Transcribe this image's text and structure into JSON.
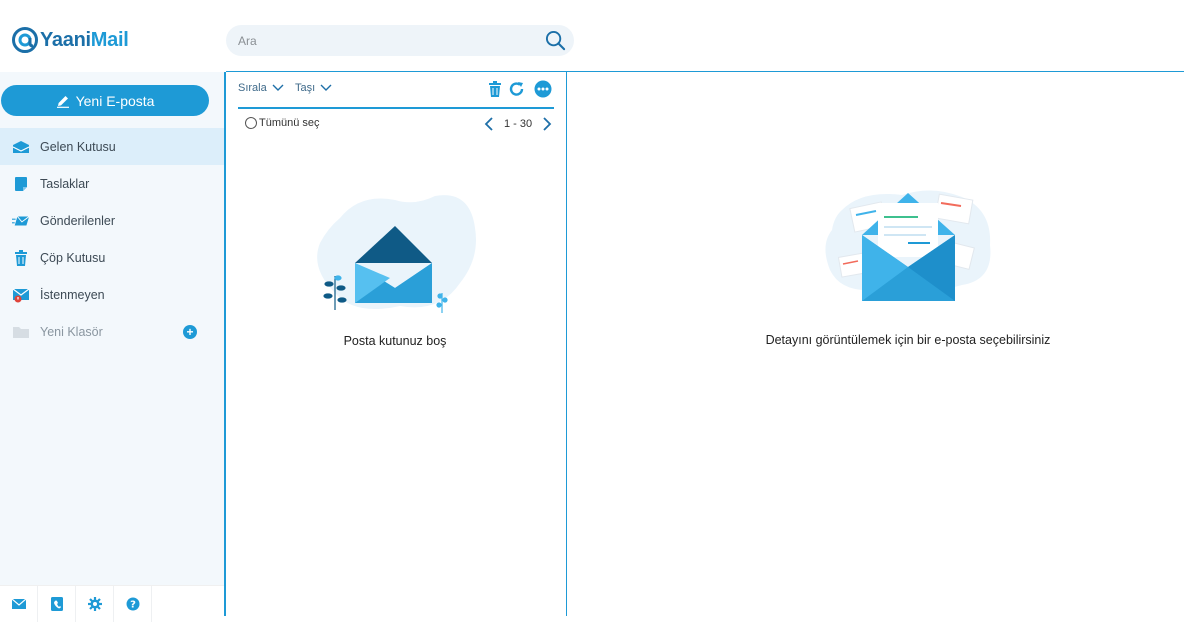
{
  "app": {
    "logo_text_a": "Yaani",
    "logo_text_b": "Mail"
  },
  "search": {
    "placeholder": "Ara",
    "icon": "search-icon"
  },
  "sidebar": {
    "compose_label": "Yeni E-posta",
    "folders": [
      {
        "label": "Gelen Kutusu",
        "icon": "inbox-icon",
        "active": true
      },
      {
        "label": "Taslaklar",
        "icon": "draft-icon"
      },
      {
        "label": "Gönderilenler",
        "icon": "sent-icon"
      },
      {
        "label": "Çöp Kutusu",
        "icon": "trash-icon"
      },
      {
        "label": "İstenmeyen",
        "icon": "spam-icon"
      },
      {
        "label": "Yeni Klasör",
        "icon": "folder-icon"
      }
    ],
    "footer_icons": [
      "mail-icon",
      "contacts-icon",
      "settings-icon",
      "help-icon"
    ]
  },
  "list": {
    "sort_label": "Sırala",
    "move_label": "Taşı",
    "select_all_label": "Tümünü seç",
    "page_range": "1 - 30",
    "empty_text": "Posta kutunuz boş"
  },
  "detail": {
    "placeholder_text": "Detayını görüntülemek için bir e-posta seçebilirsiniz"
  },
  "colors": {
    "accent": "#1e9ad6",
    "brand_dark": "#1b6fa8",
    "sidebar_bg": "#f3f8fc",
    "active_bg": "#dceefa"
  }
}
